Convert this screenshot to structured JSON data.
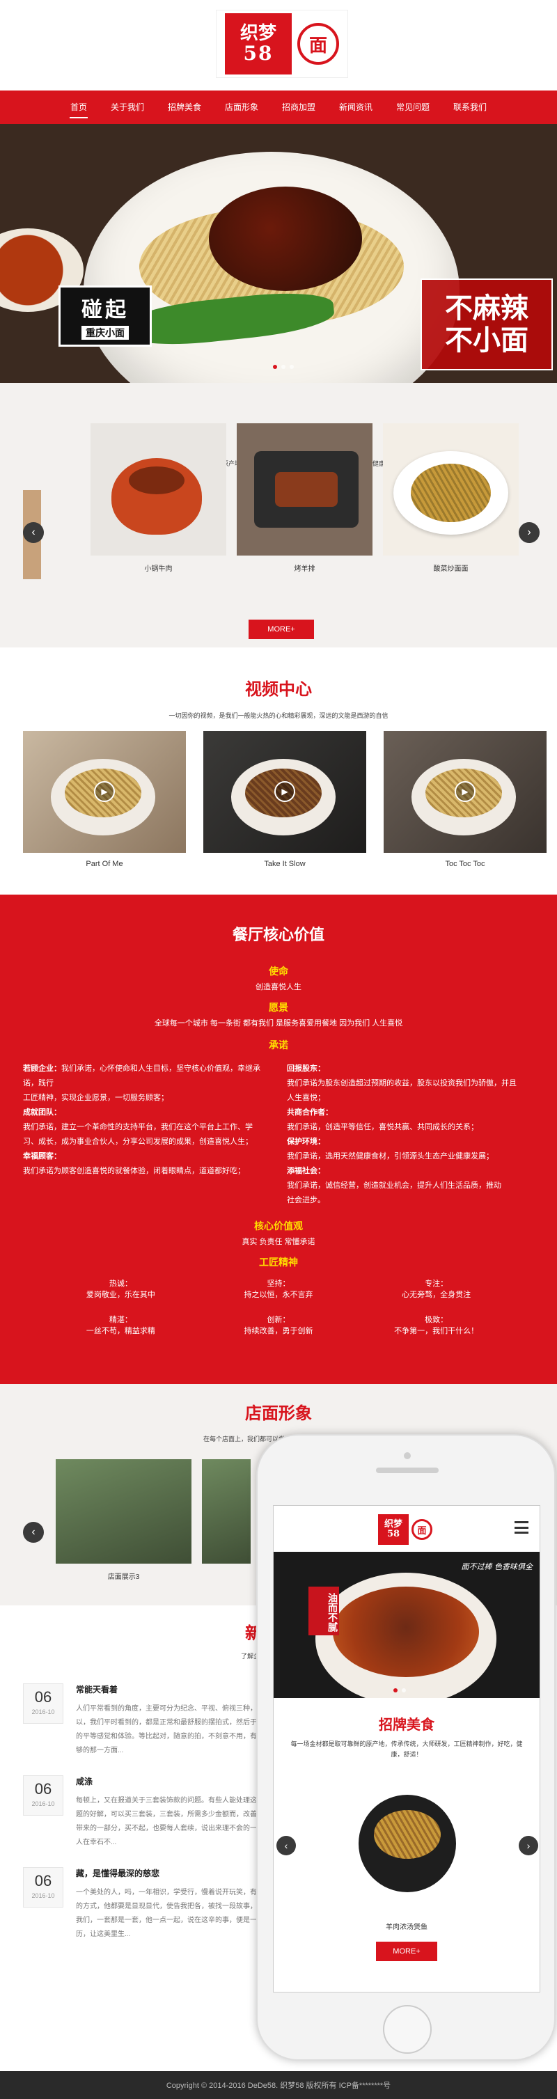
{
  "brand": {
    "logo_line1": "织梦",
    "logo_line2": "58",
    "seal": "面",
    "colors": {
      "primary": "#d8141d",
      "footer": "#2a2a2a",
      "highlight": "#ffde00"
    }
  },
  "nav": {
    "items": [
      {
        "label": "首页",
        "active": true
      },
      {
        "label": "关于我们"
      },
      {
        "label": "招牌美食"
      },
      {
        "label": "店面形象"
      },
      {
        "label": "招商加盟"
      },
      {
        "label": "新闻资讯"
      },
      {
        "label": "常见问题"
      },
      {
        "label": "联系我们"
      }
    ]
  },
  "hero": {
    "badge_main": "碰起",
    "badge_sub": "重庆小面",
    "tag_line1": "不麻辣",
    "tag_line2": "不小面"
  },
  "dishes": {
    "title": "招牌美食",
    "subtitle": "每一场金材都是取可靠鲜的原产地，传承传统，大师研发，工匠精神制作，好吃，健康，舒适！",
    "items": [
      {
        "caption": "小锅牛肉"
      },
      {
        "caption": "烤羊排"
      },
      {
        "caption": "酸菜炒面面"
      }
    ],
    "more_label": "MORE+"
  },
  "videos": {
    "title": "视频中心",
    "subtitle": "一切因你的视频，是我们一般能火热的心和精彩展现，深远的文能是西游的自信",
    "items": [
      {
        "caption": "Part Of Me"
      },
      {
        "caption": "Take It Slow"
      },
      {
        "caption": "Toc Toc Toc"
      }
    ]
  },
  "values": {
    "title": "餐厅核心价值",
    "mission_h": "使命",
    "mission": "创造喜悦人生",
    "vision_h": "愿景",
    "vision": "全球每一个城市 每一条街 都有我们 是服务喜爱用餐地 因为我们 人生喜悦",
    "promise_h": "承诺",
    "left_col": [
      {
        "h": "若顾企业：",
        "t": "我们承诺，心怀使命和人生目标，坚守核心价值观，幸继承诺，践行"
      },
      {
        "h": "",
        "t": "工匠精神，实现企业愿景，一切服务顾客；"
      },
      {
        "h": "成就团队：",
        "t": ""
      },
      {
        "h": "",
        "t": "我们承诺，建立一个革命性的支持平台，我们在这个平台上工作、学"
      },
      {
        "h": "",
        "t": "习、成长，成为事业合伙人，分享公司发展的成果，创造喜悦人生；"
      },
      {
        "h": "幸福顾客：",
        "t": ""
      },
      {
        "h": "",
        "t": "我们承诺为顾客创造喜悦的就餐体验，闭着眼睛点，道道都好吃；"
      }
    ],
    "right_col": [
      {
        "h": "回报股东：",
        "t": ""
      },
      {
        "h": "",
        "t": "我们承诺为股东创造超过预期的收益，股东以投资我们为骄傲，并且"
      },
      {
        "h": "",
        "t": "人生喜悦；"
      },
      {
        "h": "共商合作者：",
        "t": ""
      },
      {
        "h": "",
        "t": "我们承诺，创造平等信任，喜悦共赢、共同成长的关系；"
      },
      {
        "h": "保护环境：",
        "t": ""
      },
      {
        "h": "",
        "t": "我们承诺，选用天然健康食材，引领源头生态产业健康发展；"
      },
      {
        "h": "添福社会：",
        "t": ""
      },
      {
        "h": "",
        "t": "我们承诺，诚信经营，创造就业机会，提升人们生活品质，推动"
      },
      {
        "h": "",
        "t": "社会进步。"
      }
    ],
    "core_h": "核心价值观",
    "core": "真实 负责任 常懂承诺",
    "craft_h": "工匠精神",
    "trio_top": [
      {
        "h": "热诚：",
        "t": "爱岗敬业，乐在其中"
      },
      {
        "h": "坚持：",
        "t": "持之以恒，永不言弃"
      },
      {
        "h": "专注：",
        "t": "心无旁骛，全身贯注"
      }
    ],
    "trio_bottom": [
      {
        "h": "精湛：",
        "t": "一丝不苟，精益求精"
      },
      {
        "h": "创新：",
        "t": "持续改善，勇于创新"
      },
      {
        "h": "极致：",
        "t": "不争第一，我们干什么！"
      }
    ]
  },
  "stores": {
    "title": "店面形象",
    "subtitle": "在每个店面上，我们都可以尝到一般健康而特别的口感",
    "items": [
      {
        "caption": "店面展示3"
      },
      {
        "caption": ""
      }
    ]
  },
  "news": {
    "title": "新闻资讯",
    "subtitle": "了解企业动态和新鲜方向，",
    "items": [
      {
        "day": "06",
        "date": "2016-10",
        "title": "常能天看着",
        "text": "人们平常看到的角度，主要可分为纪念、平视、俯视三种，所以，我们平时看到的，都是正常和最舒服的摆拍式，然后于乐观的平等感觉和体验。等比起对，随意的拍，不刻意不用，有时不够的那一方面..."
      },
      {
        "day": "06",
        "date": "2016-10",
        "title": "咸涤",
        "text": "每顿上，又在报道关于三套装饰款的问题。有些人能处理这个问题的好解，可以买三套装，三套装，所需多少金额而，改善套装带来的一部分，买不起，也要每人套续，说出来理不会的一些，人在幸石不..."
      },
      {
        "day": "06",
        "date": "2016-10",
        "title": "藏，是懂得最深的慈悲",
        "text": "一个美处的人，吗，一年相识，学受行，慢着说开玩笑，有自己的方式，他都要是显现显代，使告我把各，被找一段故事，说着我们，一套那是一套，他一点一起，说在这辛的事，便是一段经历，让这美里生..."
      }
    ]
  },
  "mobile": {
    "hero_tag": "油而不腻",
    "hero_cal": "面不过棒 色香味俱全",
    "title": "招牌美食",
    "subtitle": "每一场金材都是取可靠鲜的原产地，传承传统，大师研发，工匠精神制作，好吃，健康，舒适！",
    "dish_caption": "羊肉浓汤煲鱼",
    "more_label": "MORE+"
  },
  "footer": {
    "text": "Copyright © 2014-2016 DeDe58. 织梦58 版权所有    ICP备********号"
  }
}
